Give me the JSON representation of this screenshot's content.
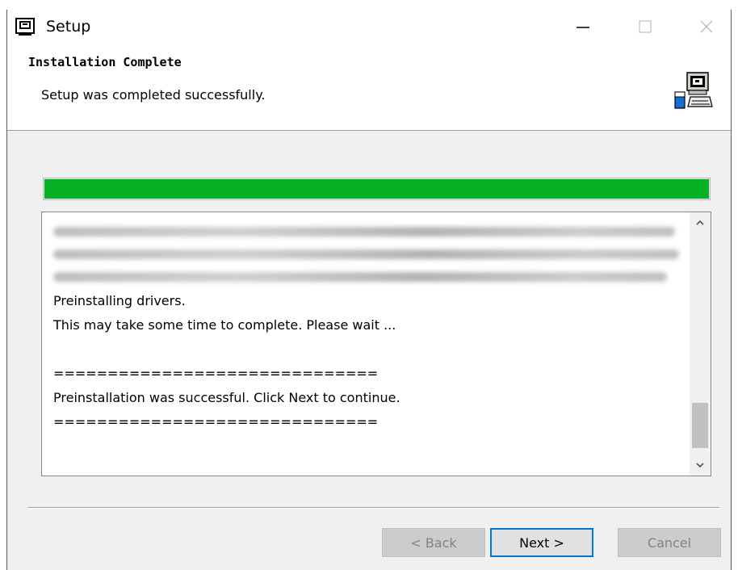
{
  "window": {
    "title": "Setup",
    "icon": "setup-app-icon",
    "controls": [
      "minimize",
      "maximize",
      "close"
    ]
  },
  "header": {
    "heading": "Installation Complete",
    "subheading": "Setup was completed successfully.",
    "icon": "computer-install-icon"
  },
  "progress": {
    "percent": 100,
    "color": "#06b025"
  },
  "log": {
    "lines": [
      "Preinstalling drivers.",
      "This may take some time to complete. Please wait ...",
      "",
      "==============================",
      "Preinstallation was successful. Click Next to continue.",
      "=============================="
    ]
  },
  "buttons": {
    "back": "< Back",
    "next": "Next >",
    "cancel": "Cancel"
  },
  "colors": {
    "accent": "#0078d7",
    "progress": "#06b025"
  }
}
